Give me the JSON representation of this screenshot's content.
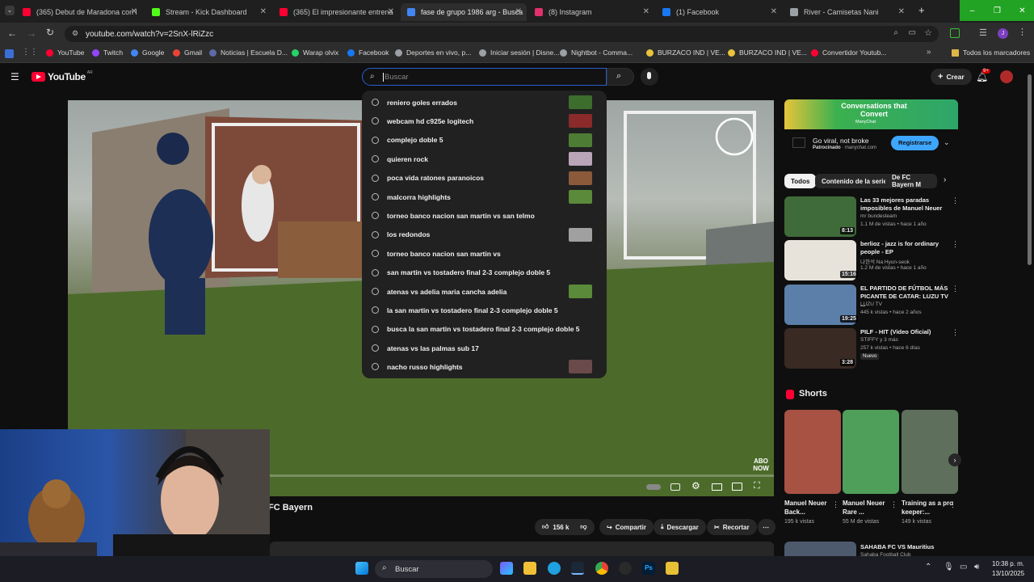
{
  "browser": {
    "tabs": [
      {
        "label": "(365) Debut de Maradona con l",
        "color": "#ff0033"
      },
      {
        "label": "Stream - Kick Dashboard",
        "color": "#53fc18"
      },
      {
        "label": "(365) El impresionante entrena",
        "color": "#ff0033"
      },
      {
        "label": "fase de grupo 1986 arg - Busca",
        "color": "#4285f4"
      },
      {
        "label": "(8) Instagram",
        "color": "#e1306c"
      },
      {
        "label": "(1) Facebook",
        "color": "#1877f2"
      },
      {
        "label": "River - Camisetas Nani",
        "color": "#9aa0a6"
      }
    ],
    "url": "youtube.com/watch?v=2SnX-lRiZzc",
    "bookmarks": [
      {
        "label": "YouTube",
        "color": "#ff0033"
      },
      {
        "label": "Twitch",
        "color": "#9146ff"
      },
      {
        "label": "Google",
        "color": "#4285f4"
      },
      {
        "label": "Gmail",
        "color": "#ea4335"
      },
      {
        "label": "Noticias | Escuela D...",
        "color": "#5f6aa8"
      },
      {
        "label": "Warap olvix",
        "color": "#25d366"
      },
      {
        "label": "Facebook",
        "color": "#1877f2"
      },
      {
        "label": "Deportes en vivo, p...",
        "color": "#9aa0a6"
      },
      {
        "label": "Iniciar sesión | Disne...",
        "color": "#9aa0a6"
      },
      {
        "label": "Nightbot - Comma...",
        "color": "#9aa0a6"
      },
      {
        "label": "BURZACO IND | VE...",
        "color": "#e8c33b"
      },
      {
        "label": "BURZACO IND | VE...",
        "color": "#e8c33b"
      },
      {
        "label": "Convertidor Youtub...",
        "color": "#ff0033"
      }
    ],
    "all_bookmarks": "Todos los marcadores"
  },
  "youtube": {
    "logo": "YouTube",
    "region": "AR",
    "search_placeholder": "Buscar",
    "create_label": "Crear",
    "notif_count": "9+",
    "suggestions": [
      {
        "text": "reniero goles errados",
        "thumb": "#3c6d2c"
      },
      {
        "text": "webcam hd c925e logitech",
        "thumb": "#8a2a2a"
      },
      {
        "text": "complejo doble 5",
        "thumb": "#4d7d35"
      },
      {
        "text": "quieren rock",
        "thumb": "#b9a4b8"
      },
      {
        "text": "poca vida ratones paranoicos",
        "thumb": "#8a5a3a"
      },
      {
        "text": "malcorra highlights",
        "thumb": "#5a8a3a"
      },
      {
        "text": "torneo banco nacion san martin vs san telmo",
        "thumb": ""
      },
      {
        "text": "los redondos",
        "thumb": "#a0a0a0"
      },
      {
        "text": "torneo banco nacion san martin vs",
        "thumb": ""
      },
      {
        "text": "san martin vs tostadero final 2-3 complejo doble 5",
        "thumb": ""
      },
      {
        "text": "atenas vs adelia maria cancha adelia",
        "thumb": "#5a8a3a"
      },
      {
        "text": "la san martin vs tostadero final 2-3 complejo doble 5",
        "thumb": ""
      },
      {
        "text": "busca la san martin vs tostadero final 2-3 complejo doble 5",
        "thumb": ""
      },
      {
        "text": "atenas vs las palmas sub 17",
        "thumb": ""
      },
      {
        "text": "nacho russo highlights",
        "thumb": "#6a4a4a"
      }
    ],
    "video": {
      "channel_fragment": "FC Bayern",
      "watermark": "ABO NOW",
      "likes": "156 k",
      "share": "Compartir",
      "download": "Descargar",
      "clip": "Recortar"
    },
    "ad": {
      "banner_title": "Conversations that Convert",
      "banner_brand": "ManyChat",
      "title": "Go viral, not broke",
      "sponsor": "Patrocinado",
      "domain": "manychat.com",
      "cta": "Registrarse"
    },
    "chips": [
      "Todos",
      "Contenido de la serie",
      "De FC Bayern M"
    ],
    "related": [
      {
        "title": "Las 33 mejores paradas imposibles de Manuel Neuer",
        "channel": "mr bundesteam",
        "meta": "1.1 M de vistas • hace 1 año",
        "duration": "8:13",
        "color": "#3f6b3a"
      },
      {
        "title": "berlioz - jazz is for ordinary people - EP",
        "channel": "나현석 Na Hyun-seok",
        "meta": "1.2 M de vistas • hace 1 año",
        "duration": "15:16",
        "color": "#e7e3da"
      },
      {
        "title": "EL PARTIDO DE FÚTBOL MÁS PICANTE DE CATAR: LUZU TV ...",
        "channel": "LUZU TV",
        "meta": "445 k vistas • hace 2 años",
        "duration": "19:25",
        "color": "#5b7fa8"
      },
      {
        "title": "PILF - HIT (Video Oficial)",
        "channel": "STIFFY y 3 más",
        "meta": "257 k vistas • hace 6 días",
        "duration": "3:28",
        "color": "#3a2a24",
        "badge": "Nuevo"
      }
    ],
    "shorts_label": "Shorts",
    "shorts": [
      {
        "title": "Manuel Neuer Back...",
        "views": "195 k vistas",
        "color": "#a85244"
      },
      {
        "title": "Manuel Neuer Rare ...",
        "views": "55 M de vistas",
        "color": "#4f9e5a"
      },
      {
        "title": "Training as a pro keeper:...",
        "views": "149 k vistas",
        "color": "#5e6f5c"
      }
    ],
    "bottom_video_title": "SAHABA FC VS Mauritius",
    "bottom_video_channel": "Sahaba Football Club"
  },
  "taskbar": {
    "search": "Buscar",
    "time": "10:38 p. m.",
    "date": "13/10/2025"
  }
}
